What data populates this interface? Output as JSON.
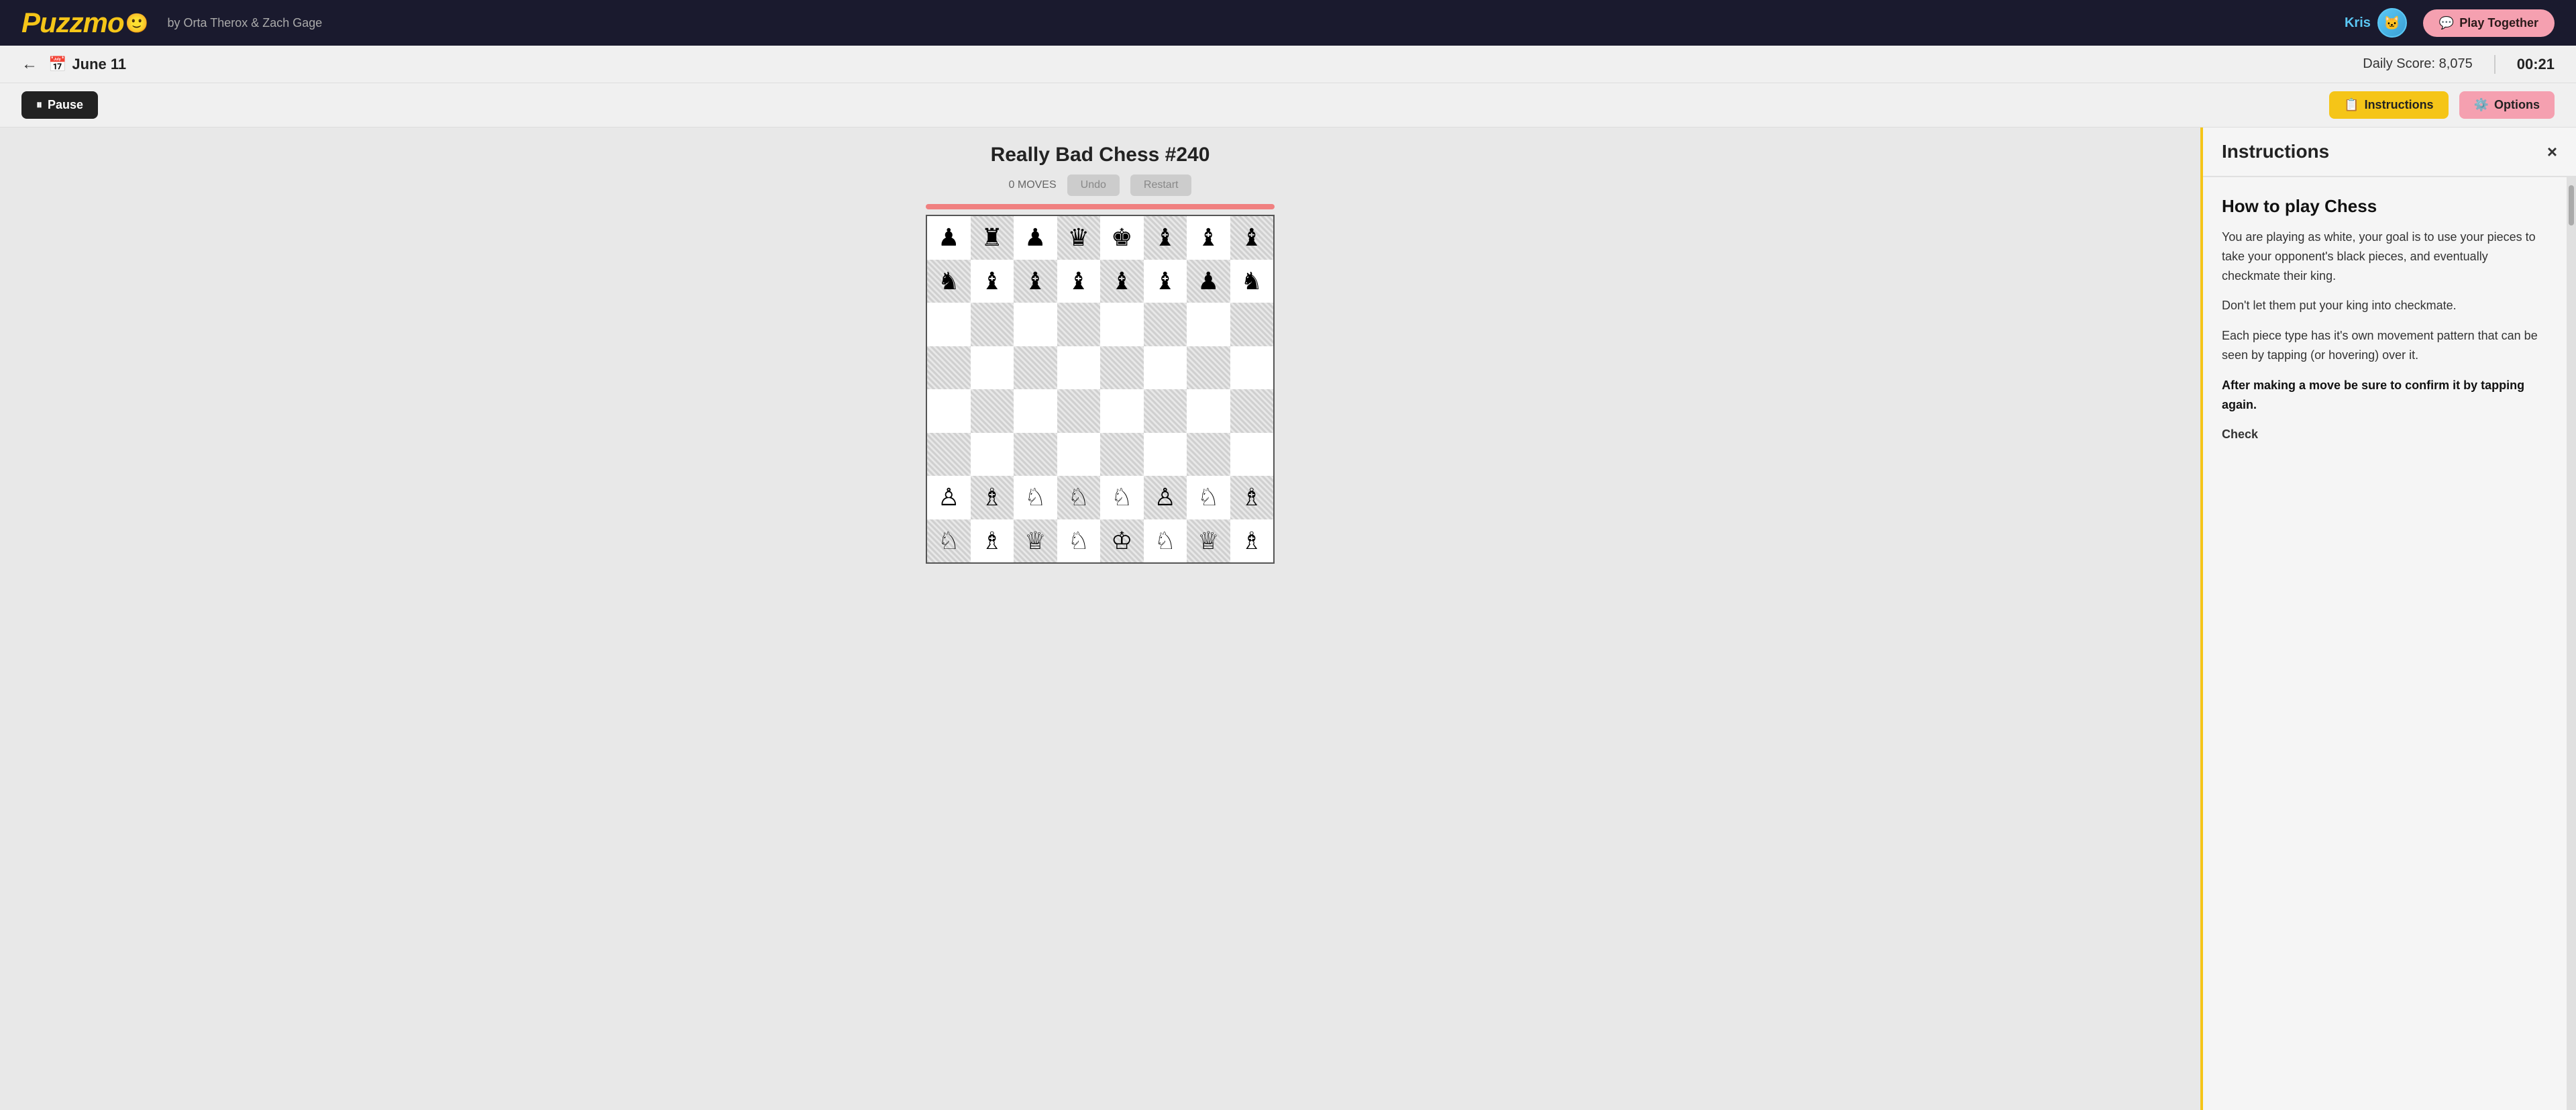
{
  "header": {
    "logo_text": "Puzzmo",
    "logo_emoji": "😀",
    "by_text": "by Orta Therox  &  Zach Gage",
    "user_name": "Kris",
    "play_together_label": "Play Together",
    "play_together_icon": "💬"
  },
  "sub_header": {
    "date": "June 11",
    "daily_score_label": "Daily Score:",
    "daily_score_value": "8,075",
    "timer": "00:21"
  },
  "toolbar": {
    "pause_label": "Pause",
    "pause_icon": "⏸",
    "instructions_label": "Instructions",
    "instructions_icon": "📋",
    "options_label": "Options",
    "options_icon": "⚙️"
  },
  "game": {
    "title": "Really Bad Chess #240",
    "moves_label": "0 MOVES",
    "undo_label": "Undo",
    "restart_label": "Restart"
  },
  "instructions_panel": {
    "title": "Instructions",
    "close_icon": "×",
    "heading": "How to play Chess",
    "paragraph1": "You are playing as white, your goal is to use your pieces to take your opponent's black pieces, and eventually checkmate their king.",
    "paragraph2": "Don't let them put your king into checkmate.",
    "paragraph3": "Each piece type has it's own movement pattern that can be seen by tapping (or hovering) over it.",
    "paragraph4_bold": "After making a move be sure to confirm it by tapping again.",
    "paragraph5_label": "Check"
  },
  "chess_board": {
    "pieces": [
      [
        "♟",
        "♜",
        "♟",
        "♛",
        "♚",
        "♝",
        "♝",
        "♝"
      ],
      [
        "♞",
        "♝",
        "♝",
        "♝",
        "♝",
        "♝",
        "♟",
        "♞"
      ],
      [
        " ",
        " ",
        " ",
        " ",
        " ",
        " ",
        " ",
        " "
      ],
      [
        " ",
        " ",
        " ",
        " ",
        " ",
        " ",
        " ",
        " "
      ],
      [
        " ",
        " ",
        " ",
        " ",
        " ",
        " ",
        " ",
        " "
      ],
      [
        " ",
        " ",
        " ",
        " ",
        " ",
        " ",
        " ",
        " "
      ],
      [
        "♙",
        "♗",
        "♘",
        "♘",
        "♘",
        "♙",
        "♘",
        "♗"
      ],
      [
        "♘",
        "♗",
        "♕",
        "♘",
        "♔",
        "♘",
        "♕",
        "♗"
      ]
    ]
  },
  "colors": {
    "header_bg": "#1a1a2e",
    "logo_yellow": "#f5c518",
    "instructions_border": "#f5c518",
    "options_bg": "#f5a0b0",
    "user_color": "#5bc8f5"
  }
}
